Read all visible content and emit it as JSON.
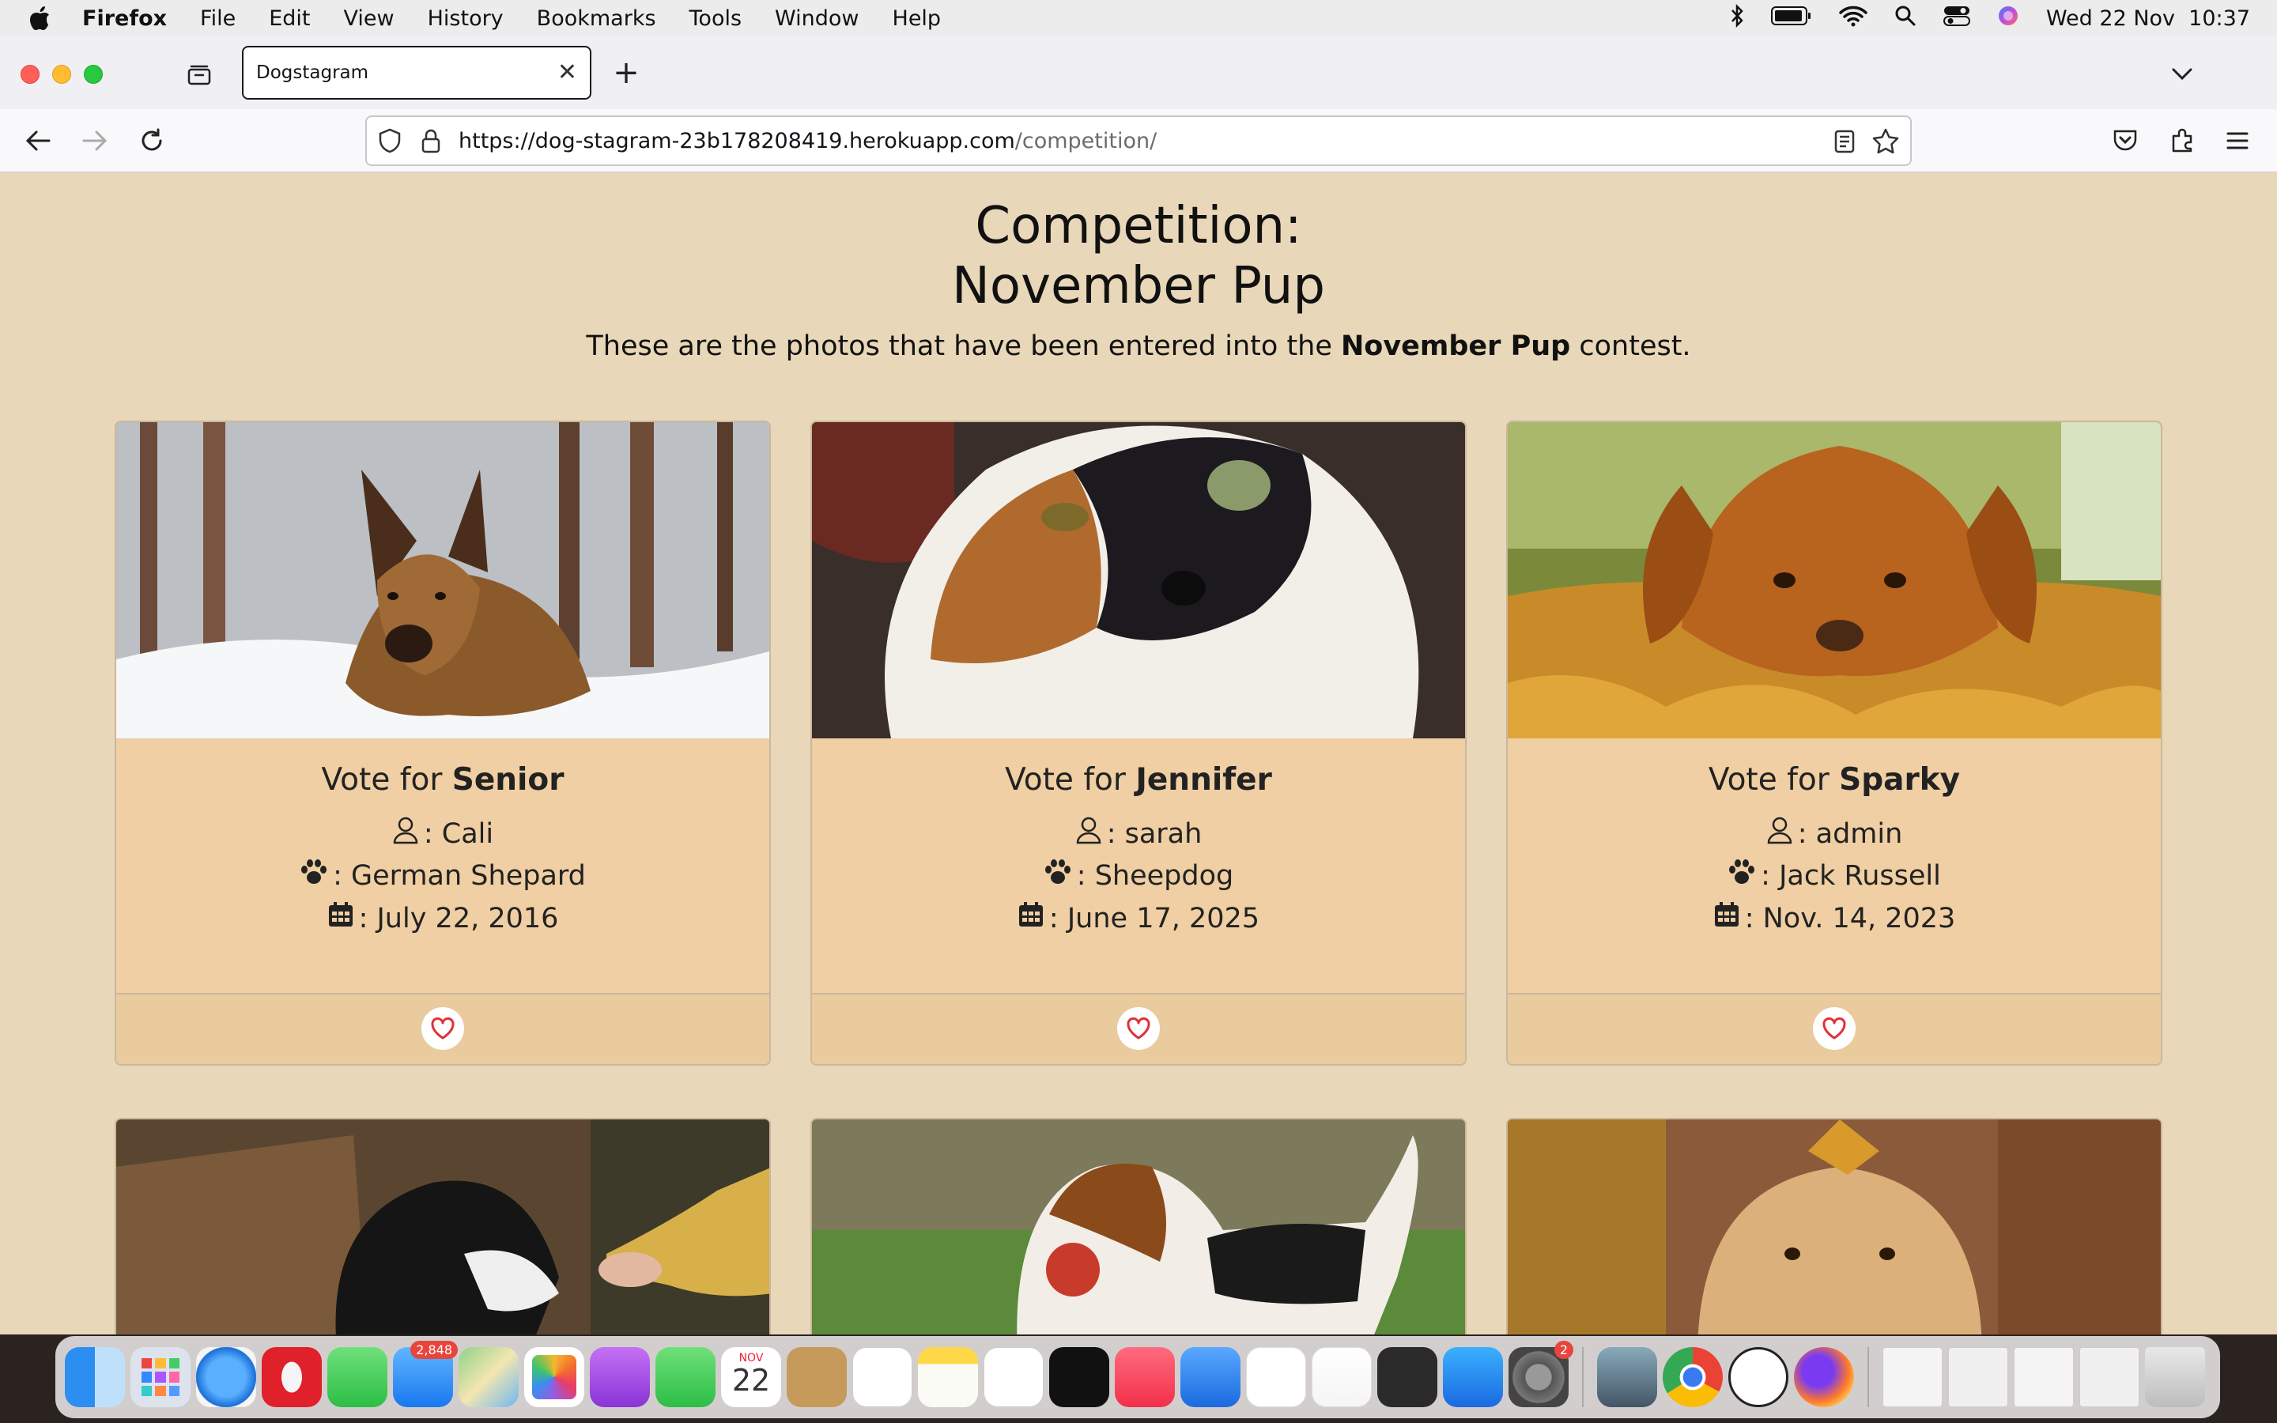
{
  "menubar": {
    "app_name": "Firefox",
    "items": [
      "File",
      "Edit",
      "View",
      "History",
      "Bookmarks",
      "Tools",
      "Window",
      "Help"
    ],
    "clock": "Wed 22 Nov  10:37"
  },
  "browser": {
    "tab_title": "Dogstagram",
    "url_host": "https://dog-stagram-23b178208419.herokuapp.com",
    "url_path": "/competition/"
  },
  "page": {
    "title_line1": "Competition:",
    "title_line2": "November Pup",
    "subtitle_pre": "These are the photos that have been entered into the ",
    "subtitle_bold": "November Pup",
    "subtitle_post": " contest.",
    "vote_prefix": "Vote for ",
    "cards": [
      {
        "name": "Senior",
        "owner": "Cali",
        "breed": "German Shepard",
        "date": "July 22, 2016"
      },
      {
        "name": "Jennifer",
        "owner": "sarah",
        "breed": "Sheepdog",
        "date": "June 17, 2025"
      },
      {
        "name": "Sparky",
        "owner": "admin",
        "breed": "Jack Russell",
        "date": "Nov. 14, 2023"
      }
    ]
  },
  "dock": {
    "mail_badge": "2,848",
    "calendar_month": "NOV",
    "calendar_day": "22",
    "settings_badge": "2"
  },
  "colors": {
    "page_bg": "#e8d7b8",
    "card_bg": "#efcfa3",
    "heart": "#e0303a"
  }
}
